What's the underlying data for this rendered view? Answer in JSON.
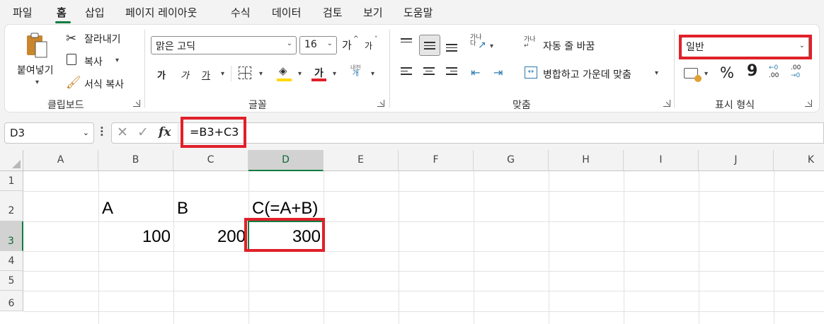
{
  "menu_tabs": [
    "파일",
    "홈",
    "삽입",
    "페이지 레이아웃",
    "수식",
    "데이터",
    "검토",
    "보기",
    "도움말"
  ],
  "active_tab": "홈",
  "clipboard": {
    "paste_label": "붙여넣기",
    "cut_label": "잘라내기",
    "copy_label": "복사",
    "format_painter_label": "서식 복사",
    "group_label": "클립보드"
  },
  "font": {
    "font_name": "맑은 고딕",
    "font_size": "16",
    "increase_label": "가",
    "decrease_label": "가",
    "bold_label": "가",
    "italic_label": "가",
    "underline_label": "가",
    "font_color_label": "가",
    "phonetic_label_1": "내천",
    "phonetic_label_2": "개",
    "group_label": "글꼴"
  },
  "alignment": {
    "wrap_text_label": "자동 줄 바꿈",
    "merge_center_label": "병합하고 가운데 맞춤",
    "orientation_label_1": "가나",
    "orientation_label_2": "다",
    "group_label": "맞춤"
  },
  "number": {
    "format_value": "일반",
    "percent_label": "%",
    "comma_label": "9",
    "increase_decimal_label": ".00",
    "decrease_decimal_label": ".00",
    "decimal_top_label": "←0",
    "decimal_bottom_label": "→0",
    "group_label": "표시 형식"
  },
  "formula_bar": {
    "name_box": "D3",
    "formula": "=B3+C3",
    "fx_label": "fx"
  },
  "columns": [
    "A",
    "B",
    "C",
    "D",
    "E",
    "F",
    "G",
    "H",
    "I",
    "J",
    "K"
  ],
  "rows": [
    "1",
    "2",
    "3",
    "4",
    "5",
    "6"
  ],
  "cells": {
    "B2": "A",
    "C2": "B",
    "D2": "C(=A+B)",
    "B3": "100",
    "C3": "200",
    "D3": "300"
  },
  "colors": {
    "highlight_red": "#e0202a",
    "excel_green": "#107c41",
    "fill_yellow": "#ffd800",
    "font_red": "#e0202a"
  }
}
